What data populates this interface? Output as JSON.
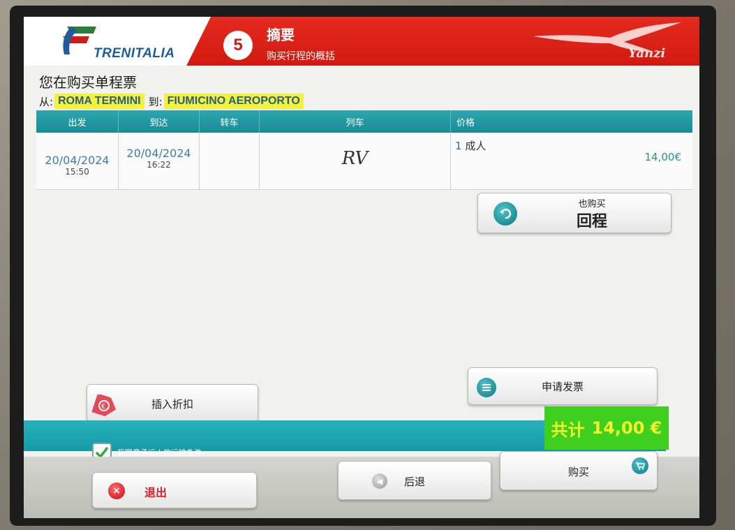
{
  "header": {
    "brand": "TRENITALIA",
    "step_number": "5",
    "title": "摘要",
    "subtitle": "购买行程的概括",
    "partner": "Yanzi"
  },
  "purchase": {
    "title": "您在购买单程票",
    "from_label": "从:",
    "from_station": "ROMA TERMINI",
    "to_label": "到:",
    "to_station": "FIUMICINO AEROPORTO"
  },
  "table": {
    "headers": {
      "departure": "出发",
      "arrival": "到达",
      "transfer": "转车",
      "train": "列车",
      "price": "价格"
    },
    "row": {
      "departure_date": "20/04/2024",
      "departure_time": "15:50",
      "arrival_date": "20/04/2024",
      "arrival_time": "16:22",
      "transfer": "",
      "train": "RV",
      "passenger_count": "1",
      "passenger_type": "成人",
      "price": "14,00€"
    }
  },
  "buttons": {
    "return_small": "也购买",
    "return_big": "回程",
    "invoice": "申请发票",
    "discount": "插入折扣",
    "exit": "退出",
    "back": "后退",
    "buy": "购买"
  },
  "total": {
    "label": "共计",
    "amount": "14,00 €"
  },
  "agreement": {
    "text": "我同意承运人的运输条件",
    "checked": true
  },
  "colors": {
    "header_red": "#d11a12",
    "teal": "#178c96",
    "total_green": "#3fd01f",
    "highlight_yellow": "#f2f23a"
  }
}
